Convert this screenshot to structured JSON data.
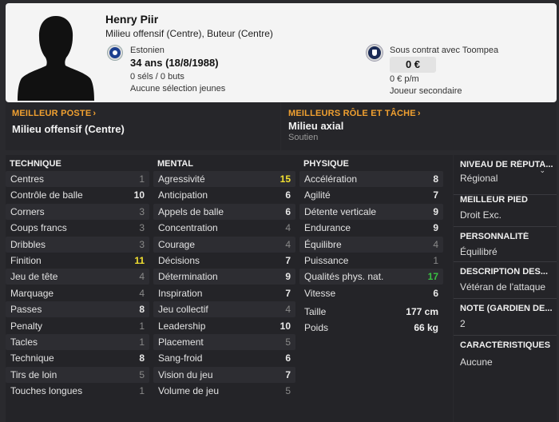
{
  "player": {
    "name": "Henry Piir",
    "roles": "Milieu offensif (Centre), Buteur (Centre)",
    "nationality": "Estonien",
    "age": "34 ans (18/8/1988)",
    "caps": "0 séls / 0 buts",
    "youth": "Aucune sélection jeunes",
    "contract": "Sous contrat avec Toompea",
    "value": "0 €",
    "wage": "0 € p/m",
    "squad_status": "Joueur secondaire"
  },
  "best_position": {
    "title": "MEILLEUR POSTE",
    "value": "Milieu offensif (Centre)"
  },
  "best_role": {
    "title": "MEILLEURS RÔLE ET TÂCHE",
    "value": "Milieu axial",
    "duty": "Soutien"
  },
  "technical": {
    "title": "TECHNIQUE",
    "rows": [
      {
        "label": "Centres",
        "value": "1"
      },
      {
        "label": "Contrôle de balle",
        "value": "10"
      },
      {
        "label": "Corners",
        "value": "3"
      },
      {
        "label": "Coups francs",
        "value": "3"
      },
      {
        "label": "Dribbles",
        "value": "3"
      },
      {
        "label": "Finition",
        "value": "11"
      },
      {
        "label": "Jeu de tête",
        "value": "4"
      },
      {
        "label": "Marquage",
        "value": "4"
      },
      {
        "label": "Passes",
        "value": "8"
      },
      {
        "label": "Penalty",
        "value": "1"
      },
      {
        "label": "Tacles",
        "value": "1"
      },
      {
        "label": "Technique",
        "value": "8"
      },
      {
        "label": "Tirs de loin",
        "value": "5"
      },
      {
        "label": "Touches longues",
        "value": "1"
      }
    ]
  },
  "mental": {
    "title": "MENTAL",
    "rows": [
      {
        "label": "Agressivité",
        "value": "15"
      },
      {
        "label": "Anticipation",
        "value": "6"
      },
      {
        "label": "Appels de balle",
        "value": "6"
      },
      {
        "label": "Concentration",
        "value": "4"
      },
      {
        "label": "Courage",
        "value": "4"
      },
      {
        "label": "Décisions",
        "value": "7"
      },
      {
        "label": "Détermination",
        "value": "9"
      },
      {
        "label": "Inspiration",
        "value": "7"
      },
      {
        "label": "Jeu collectif",
        "value": "4"
      },
      {
        "label": "Leadership",
        "value": "10"
      },
      {
        "label": "Placement",
        "value": "5"
      },
      {
        "label": "Sang-froid",
        "value": "6"
      },
      {
        "label": "Vision du jeu",
        "value": "7"
      },
      {
        "label": "Volume de jeu",
        "value": "5"
      }
    ]
  },
  "physical": {
    "title": "PHYSIQUE",
    "rows": [
      {
        "label": "Accélération",
        "value": "8"
      },
      {
        "label": "Agilité",
        "value": "7"
      },
      {
        "label": "Détente verticale",
        "value": "9"
      },
      {
        "label": "Endurance",
        "value": "9"
      },
      {
        "label": "Équilibre",
        "value": "4"
      },
      {
        "label": "Puissance",
        "value": "1"
      },
      {
        "label": "Qualités phys. nat.",
        "value": "17"
      },
      {
        "label": "Vitesse",
        "value": "6"
      }
    ],
    "height_label": "Taille",
    "height": "177 cm",
    "weight_label": "Poids",
    "weight": "66 kg"
  },
  "sidebar": {
    "reputation_title": "NIVEAU DE RÉPUTA...",
    "reputation": "Régional",
    "foot_title": "MEILLEUR PIED",
    "foot": "Droit Exc.",
    "personality_title": "PERSONNALITÉ",
    "personality": "Équilibré",
    "media_title": "DESCRIPTION DES...",
    "media": "Vétéran de l'attaque",
    "gk_title": "NOTE (GARDIEN DE...",
    "gk": "2",
    "traits_title": "CARACTÉRISTIQUES J",
    "traits": "Aucune"
  },
  "colors": {
    "accent": "#f0a030",
    "high_yellow": "#f2e030",
    "high_green": "#39c142"
  }
}
